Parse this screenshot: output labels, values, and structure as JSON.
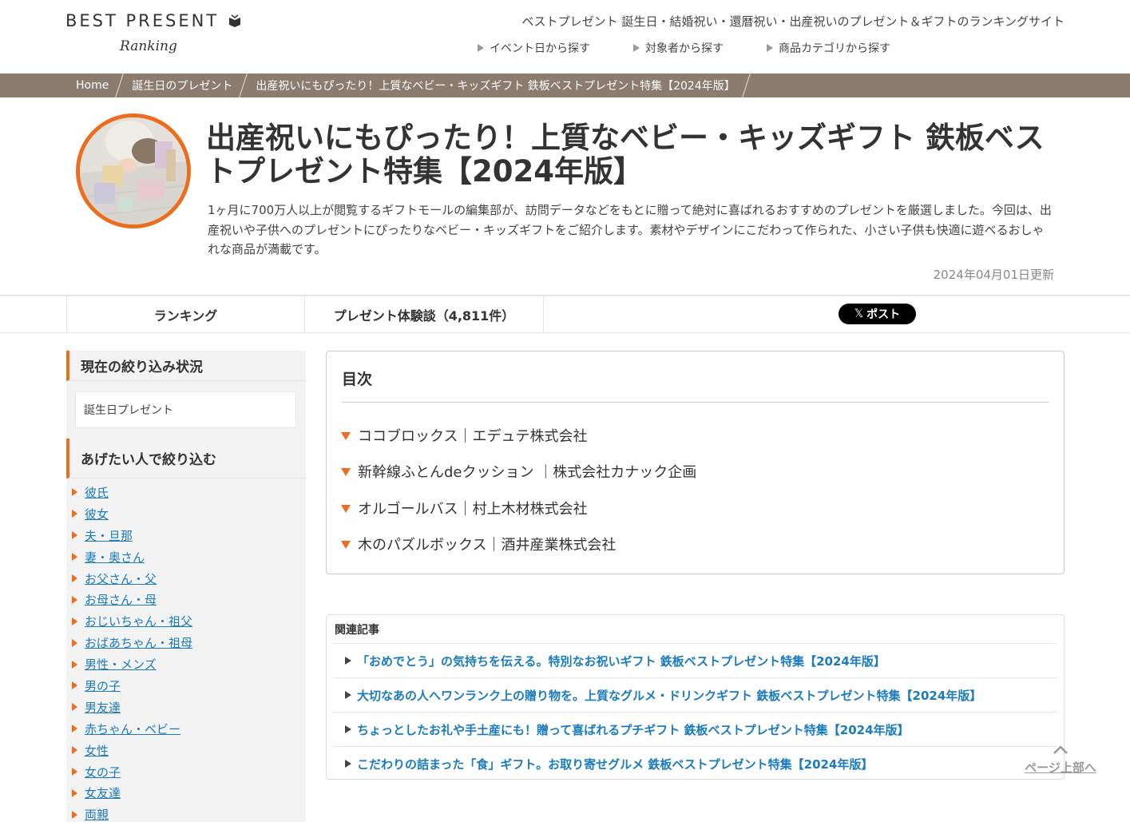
{
  "header": {
    "logo_main": "BEST PRESENT",
    "logo_sub": "Ranking",
    "tagline": "ベストプレゼント 誕生日・結婚祝い・還暦祝い・出産祝いのプレゼント＆ギフトのランキングサイト",
    "nav": [
      "イベント日から探す",
      "対象者から探す",
      "商品カテゴリから探す"
    ]
  },
  "breadcrumb": [
    "Home",
    "誕生日のプレゼント",
    "出産祝いにもぴったり！上質なベビー・キッズギフト 鉄板ベストプレゼント特集【2024年版】"
  ],
  "article": {
    "title": "出産祝いにもぴったり！上質なベビー・キッズギフト 鉄板ベストプレゼント特集【2024年版】",
    "intro": "1ヶ月に700万人以上が閲覧するギフトモールの編集部が、訪問データなどをもとに贈って絶対に喜ばれるおすすめのプレゼントを厳選しました。今回は、出産祝いや子供へのプレゼントにぴったりなベビー・キッズギフトをご紹介します。素材やデザインにこだわって作られた、小さい子供も快適に遊べるおしゃれな商品が満載です。",
    "updated": "2024年04月01日更新"
  },
  "tabs": {
    "ranking": "ランキング",
    "reviews": "プレゼント体験談（4,811件）",
    "post": "ポスト"
  },
  "sidebar": {
    "current_heading": "現在の絞り込み状況",
    "current_value": "誕生日プレゼント",
    "filter_heading": "あげたい人で絞り込む",
    "filters": [
      "彼氏",
      "彼女",
      "夫・旦那",
      "妻・奥さん",
      "お父さん・父",
      "お母さん・母",
      "おじいちゃん・祖父",
      "おばあちゃん・祖母",
      "男性・メンズ",
      "男の子",
      "男友達",
      "赤ちゃん・ベビー",
      "女性",
      "女の子",
      "女友達",
      "両親"
    ]
  },
  "toc": {
    "title": "目次",
    "items": [
      "ココブロックス｜エデュテ株式会社",
      "新幹線ふとんdeクッション ｜株式会社カナック企画",
      "オルゴールバス｜村上木材株式会社",
      "木のパズルボックス｜酒井産業株式会社"
    ]
  },
  "related": {
    "title": "関連記事",
    "items": [
      "「おめでとう」の気持ちを伝える。特別なお祝いギフト 鉄板ベストプレゼント特集【2024年版】",
      "大切なあの人へワンランク上の贈り物を。上質なグルメ・ドリンクギフト 鉄板ベストプレゼント特集【2024年版】",
      "ちょっとしたお礼や手土産にも！贈って喜ばれるプチギフト 鉄板ベストプレゼント特集【2024年版】",
      "こだわりの詰まった「食」ギフト。お取り寄せグルメ 鉄板ベストプレゼント特集【2024年版】"
    ]
  },
  "page_top": "ページ上部へ",
  "colors": {
    "accent": "#ed6d1f",
    "breadcrumb_bg": "#8c7b6f",
    "link": "#1a7bbf"
  }
}
